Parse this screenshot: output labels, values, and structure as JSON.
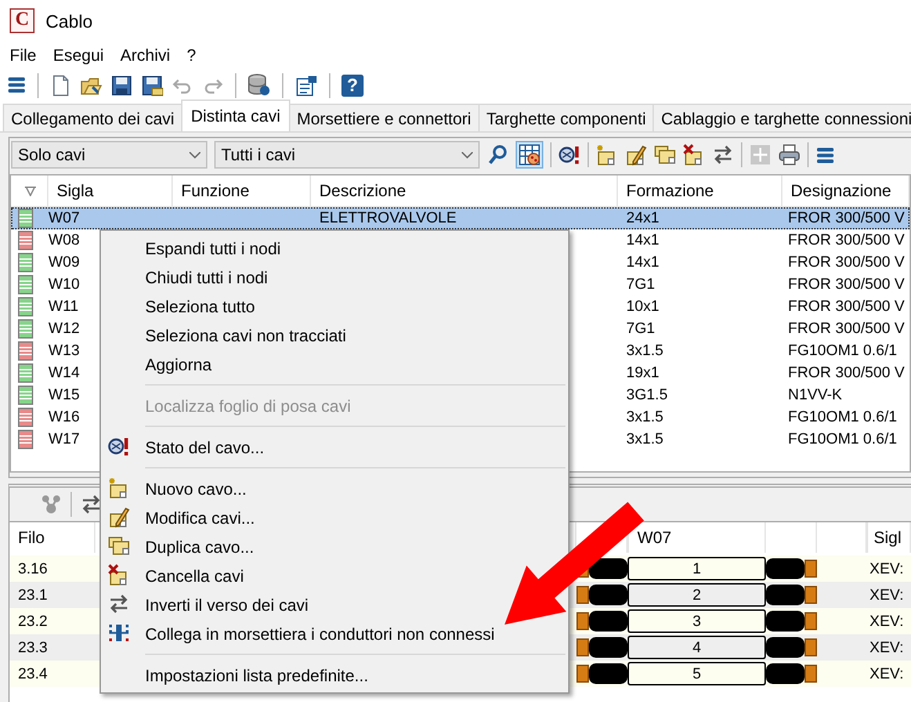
{
  "window": {
    "logo_letter": "C",
    "title": "Cablo"
  },
  "menu_bar": [
    "File",
    "Esegui",
    "Archivi",
    "?"
  ],
  "toolbar": {
    "help_glyph": "?"
  },
  "tabs": [
    {
      "label": "Collegamento dei cavi",
      "selected": false
    },
    {
      "label": "Distinta cavi",
      "selected": true
    },
    {
      "label": "Morsettiere e connettori",
      "selected": false
    },
    {
      "label": "Targhette componenti",
      "selected": false
    },
    {
      "label": "Cablaggio e targhette connessioni",
      "selected": false
    }
  ],
  "filter_bar": {
    "view_filter": "Solo cavi",
    "cable_filter": "Tutti i cavi",
    "table_view_on": true
  },
  "cable_table": {
    "columns": [
      "Sigla",
      "Funzione",
      "Descrizione",
      "Formazione",
      "Designazione"
    ],
    "rows": [
      {
        "selected": true,
        "color": "#86d48a",
        "sigla": "W07",
        "descrizione": "ELETTROVALVOLE",
        "formazione": "24x1",
        "designazione": "FROR 300/500 V"
      },
      {
        "selected": false,
        "color": "#e88a8a",
        "sigla": "W08",
        "formazione": "14x1",
        "designazione": "FROR 300/500 V"
      },
      {
        "selected": false,
        "color": "#86d48a",
        "sigla": "W09",
        "formazione": "14x1",
        "designazione": "FROR 300/500 V"
      },
      {
        "selected": false,
        "color": "#86d48a",
        "sigla": "W10",
        "formazione": "7G1",
        "designazione": "FROR 300/500 V"
      },
      {
        "selected": false,
        "color": "#86d48a",
        "sigla": "W11",
        "formazione": "10x1",
        "designazione": "FROR 300/500 V"
      },
      {
        "selected": false,
        "color": "#86d48a",
        "sigla": "W12",
        "formazione": "7G1",
        "designazione": "FROR 300/500 V"
      },
      {
        "selected": false,
        "color": "#e88a8a",
        "sigla": "W13",
        "formazione": "3x1.5",
        "designazione": "FG10OM1 0.6/1"
      },
      {
        "selected": false,
        "color": "#86d48a",
        "sigla": "W14",
        "formazione": "19x1",
        "designazione": "FROR 300/500 V"
      },
      {
        "selected": false,
        "color": "#86d48a",
        "sigla": "W15",
        "formazione": "3G1.5",
        "designazione": "N1VV-K"
      },
      {
        "selected": false,
        "color": "#e88a8a",
        "sigla": "W16",
        "formazione": "3x1.5",
        "designazione": "FG10OM1 0.6/1"
      },
      {
        "selected": false,
        "color": "#e88a8a",
        "sigla": "W17",
        "formazione": "3x1.5",
        "designazione": "FG10OM1 0.6/1"
      }
    ]
  },
  "context_menu": {
    "groups": [
      [
        {
          "label": "Espandi tutti i nodi",
          "kind": "plain",
          "disabled": false
        },
        {
          "label": "Chiudi tutti i nodi",
          "kind": "plain",
          "disabled": false
        },
        {
          "label": "Seleziona tutto",
          "kind": "plain",
          "disabled": false
        },
        {
          "label": "Seleziona cavi non tracciati",
          "kind": "plain",
          "disabled": false
        },
        {
          "label": "Aggiorna",
          "kind": "plain",
          "disabled": false
        }
      ],
      [
        {
          "label": "Localizza foglio di posa cavi",
          "kind": "plain",
          "disabled": true
        }
      ],
      [
        {
          "label": "Stato del cavo...",
          "kind": "status",
          "disabled": false
        }
      ],
      [
        {
          "label": "Nuovo cavo...",
          "kind": "new",
          "disabled": false
        },
        {
          "label": "Modifica cavi...",
          "kind": "edit",
          "disabled": false
        },
        {
          "label": "Duplica cavo...",
          "kind": "duplicate",
          "disabled": false
        },
        {
          "label": "Cancella cavi",
          "kind": "delete",
          "disabled": false
        },
        {
          "label": "Inverti il verso dei cavi",
          "kind": "swap",
          "disabled": false
        },
        {
          "label": "Collega in morsettiera i conduttori non connessi",
          "kind": "connect",
          "disabled": false
        }
      ],
      [
        {
          "label": "Impostazioni lista predefinite...",
          "kind": "plain",
          "disabled": false
        }
      ]
    ]
  },
  "wire_table": {
    "columns": [
      "Filo",
      "W07",
      "Sigl"
    ],
    "rows": [
      {
        "filo": "3.16",
        "conductor": "1",
        "sigla": "XEV:"
      },
      {
        "filo": "23.1",
        "conductor": "2",
        "sigla": "XEV:"
      },
      {
        "filo": "23.2",
        "conductor": "3",
        "sigla": "XEV:"
      },
      {
        "filo": "23.3",
        "conductor": "4",
        "sigla": "XEV:"
      },
      {
        "filo": "23.4",
        "conductor": "5",
        "sigla": "XEV:"
      }
    ]
  }
}
